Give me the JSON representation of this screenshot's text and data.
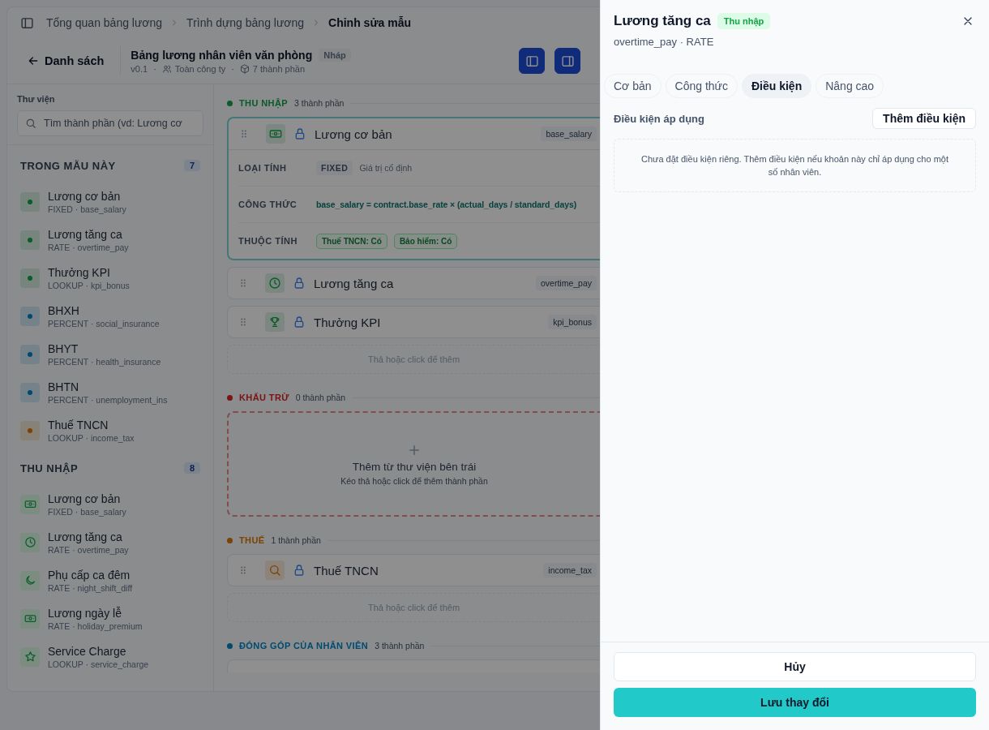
{
  "breadcrumb": {
    "items": [
      {
        "label": "Tổng quan bảng lương",
        "current": false
      },
      {
        "label": "Trình dựng bảng lương",
        "current": false
      },
      {
        "label": "Chỉnh sửa mẫu",
        "current": true
      }
    ]
  },
  "header": {
    "back_button": "Danh sách",
    "title": "Bảng lương nhân viên văn phòng",
    "status": "Nháp",
    "version": "v0.1",
    "meta_separator": "·",
    "scope": "Toàn công ty",
    "component_count": "7 thành phần",
    "view_toggles": [
      {
        "kind": "panel-left",
        "selected": true
      },
      {
        "kind": "panel-right",
        "selected": true
      }
    ]
  },
  "library": {
    "label": "Thư viện",
    "search": {
      "placeholder": "Tìm thành phần (vd: Lương cơ"
    },
    "groups": [
      {
        "title": "TRONG MẪU NÀY",
        "count": "7",
        "items": [
          {
            "kind": "dot",
            "color": "#0c5b29",
            "name": "Lương cơ bản",
            "meta": "FIXED · base_salary"
          },
          {
            "kind": "dot",
            "color": "#0c5b29",
            "name": "Lương tăng ca",
            "meta": "RATE · overtime_pay"
          },
          {
            "kind": "dot",
            "color": "#0c5b29",
            "name": "Thưởng KPI",
            "meta": "LOOKUP · kpi_bonus"
          },
          {
            "kind": "dot",
            "color": "#014a6f",
            "name": "BHXH",
            "meta": "PERCENT · social_insurance"
          },
          {
            "kind": "dot",
            "color": "#014a6f",
            "name": "BHYT",
            "meta": "PERCENT · health_insurance"
          },
          {
            "kind": "dot",
            "color": "#014a6f",
            "name": "BHTN",
            "meta": "PERCENT · unemployment_ins"
          },
          {
            "kind": "dot",
            "color": "#7a4303",
            "name": "Thuế TNCN",
            "meta": "LOOKUP · income_tax"
          }
        ]
      },
      {
        "title": "THU NHẬP",
        "count": "8",
        "items": [
          {
            "kind": "cash",
            "name": "Lương cơ bản",
            "meta": "FIXED · base_salary"
          },
          {
            "kind": "clock",
            "name": "Lương tăng ca",
            "meta": "RATE · overtime_pay"
          },
          {
            "kind": "moon",
            "name": "Phụ cấp ca đêm",
            "meta": "RATE · night_shift_diff"
          },
          {
            "kind": "cash",
            "name": "Lương ngày lễ",
            "meta": "RATE · holiday_premium"
          },
          {
            "kind": "star",
            "name": "Service Charge",
            "meta": "LOOKUP · service_charge"
          }
        ]
      }
    ]
  },
  "canvas": {
    "sections": [
      {
        "title": "THU NHẬP",
        "count": "3 thành phần",
        "color": "#0c5b29",
        "drop_hint": "Thả hoặc click để thêm",
        "cards": [
          {
            "kind": "cash",
            "name": "Lương cơ bản",
            "code": "base_salary",
            "selected": true,
            "expanded": true,
            "details": {
              "calc_label": "LOẠI TÍNH",
              "calc_type": "FIXED",
              "calc_desc": "Giá trị cố định",
              "formula_label": "CÔNG THỨC",
              "formula": "base_salary = contract.base_rate × (actual_days / standard_days)",
              "attrs_label": "THUỘC TÍNH",
              "attrs": [
                "Thuế TNCN: Có",
                "Bảo hiểm: Có"
              ]
            }
          },
          {
            "kind": "clock",
            "name": "Lương tăng ca",
            "code": "overtime_pay",
            "selected": false,
            "expanded": false
          },
          {
            "kind": "trophy",
            "name": "Thưởng KPI",
            "code": "kpi_bonus",
            "selected": false,
            "expanded": false
          }
        ]
      },
      {
        "title": "KHẤU TRỪ",
        "count": "0 thành phần",
        "color": "#7b1515",
        "empty": {
          "title": "Thêm từ thư viện bên trái",
          "hint": "Kéo thả hoặc click để thêm thành phần"
        }
      },
      {
        "title": "THUẾ",
        "count": "1 thành phần",
        "color": "#7a4303",
        "drop_hint": "Thả hoặc click để thêm",
        "cards": [
          {
            "kind": "search",
            "name": "Thuế TNCN",
            "code": "income_tax",
            "selected": false,
            "expanded": false
          }
        ]
      },
      {
        "title": "ĐÓNG GÓP CỦA NHÂN VIÊN",
        "count": "3 thành phần",
        "color": "#014a6f",
        "cards": [
          {
            "partial": true
          }
        ]
      }
    ]
  },
  "drawer": {
    "title": "Lương tăng ca",
    "category": "Thu nhập",
    "subtitle": "overtime_pay · RATE",
    "tabs": [
      {
        "label": "Cơ bản",
        "selected": false
      },
      {
        "label": "Công thức",
        "selected": false
      },
      {
        "label": "Điều kiện",
        "selected": true
      },
      {
        "label": "Nâng cao",
        "selected": false
      }
    ],
    "conditions": {
      "title": "Điều kiện áp dụng",
      "add_button": "Thêm điều kiện",
      "empty_text": "Chưa đặt điều kiện riêng. Thêm điều kiện nếu khoản này chỉ áp dụng cho một số nhân viên."
    },
    "buttons": {
      "cancel": "Hủy",
      "save": "Lưu thay đổi"
    }
  }
}
